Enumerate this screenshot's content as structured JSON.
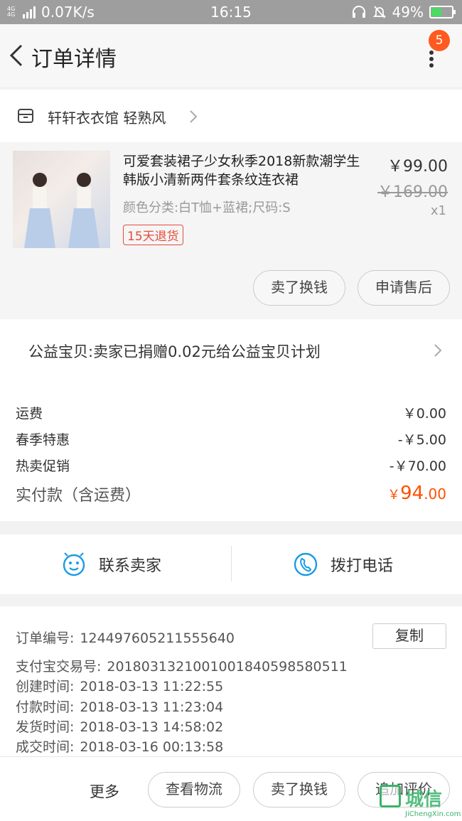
{
  "status_bar": {
    "network_type": "4G 4G",
    "speed": "0.07K/s",
    "time": "16:15",
    "battery": "49%",
    "battery_level": 0.49,
    "battery_color": "#4cd964"
  },
  "header": {
    "title": "订单详情",
    "notification_count": "5",
    "badge_color": "#ff5a1f"
  },
  "shop": {
    "name": "轩轩衣衣馆 轻熟风"
  },
  "product": {
    "title": "可爱套装裙子少女秋季2018新款潮学生韩版小清新两件套条纹连衣裙",
    "attributes": "颜色分类:白T恤+蓝裙;尺码:S",
    "tag": "15天退货",
    "price": "￥99.00",
    "original_price": "￥169.00",
    "quantity": "x1",
    "buttons": {
      "sell": "卖了换钱",
      "after_sale": "申请售后"
    }
  },
  "charity": {
    "text": "公益宝贝:卖家已捐赠0.02元给公益宝贝计划"
  },
  "fees": {
    "rows": [
      {
        "label": "运费",
        "value": "￥0.00"
      },
      {
        "label": "春季特惠",
        "value": "-￥5.00"
      },
      {
        "label": "热卖促销",
        "value": "-￥70.00"
      }
    ],
    "total_label": "实付款（含运费）",
    "total_currency": "￥",
    "total_int": "94",
    "total_dec": ".00",
    "total_color": "#ff5000"
  },
  "contact": {
    "seller": "联系卖家",
    "call": "拨打电话",
    "icon_color": "#1a9be6"
  },
  "order_info": {
    "rows": [
      {
        "key": "订单编号:",
        "value": "124497605211555640"
      },
      {
        "key": "支付宝交易号:",
        "value": "2018031321001001840598580511"
      },
      {
        "key": "创建时间:",
        "value": "2018-03-13 11:22:55"
      },
      {
        "key": "付款时间:",
        "value": "2018-03-13 11:23:04"
      },
      {
        "key": "发货时间:",
        "value": "2018-03-13 14:58:02"
      },
      {
        "key": "成交时间:",
        "value": "2018-03-16 00:13:58"
      }
    ],
    "copy_label": "复制"
  },
  "bottom_bar": {
    "more": "更多",
    "logistics": "查看物流",
    "sell": "卖了换钱",
    "review": "追加评价"
  },
  "watermark": {
    "logo_text": "城信",
    "site": "JiChengXin.com"
  }
}
